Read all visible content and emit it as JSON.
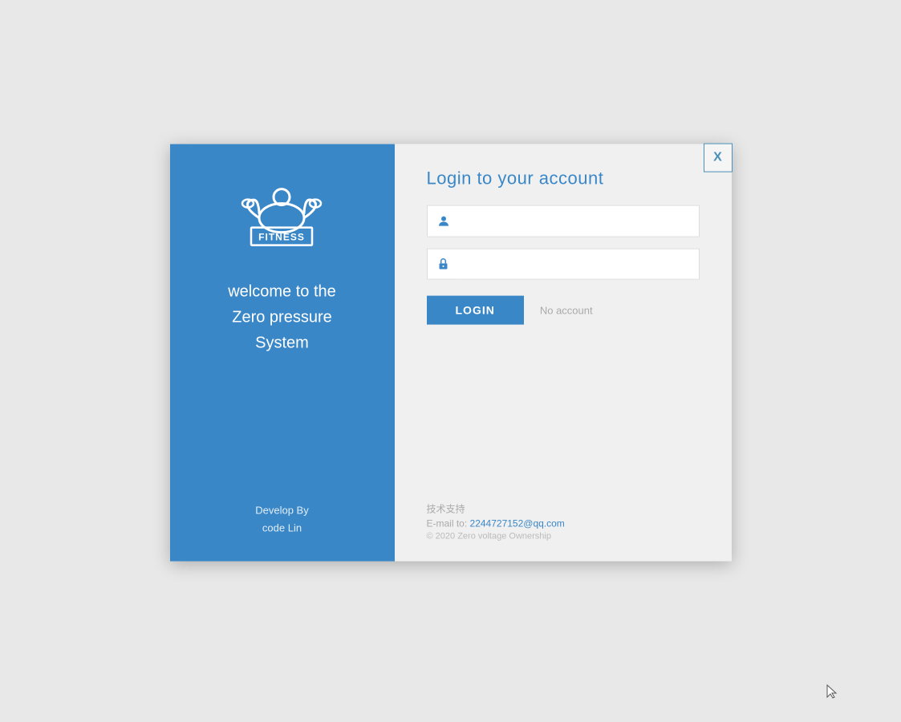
{
  "dialog": {
    "close_label": "X"
  },
  "left_panel": {
    "welcome_line1": "welcome to the",
    "welcome_line2": "Zero pressure",
    "welcome_line3": "System",
    "develop_label": "Develop By",
    "developer_name": "code Lin"
  },
  "right_panel": {
    "login_title": "Login to your account",
    "username_placeholder": "",
    "password_placeholder": "",
    "login_button": "LOGIN",
    "no_account_label": "No account"
  },
  "footer": {
    "tech_support_label": "技术支持",
    "email_label": "E-mail to:",
    "email_address": "2244727152@qq.com",
    "copyright": "© 2020  Zero voltage Ownership"
  },
  "icons": {
    "user": "👤",
    "lock": "🔒"
  }
}
